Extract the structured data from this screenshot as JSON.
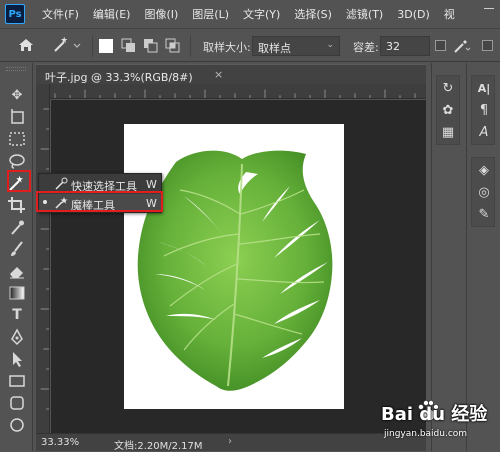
{
  "app": {
    "logo": "Ps"
  },
  "menu": [
    "文件(F)",
    "编辑(E)",
    "图像(I)",
    "图层(L)",
    "文字(Y)",
    "选择(S)",
    "滤镜(T)",
    "3D(D)",
    "视"
  ],
  "options": {
    "sample_size_label": "取样大小:",
    "sample_size_value": "取样点",
    "tolerance_label": "容差:",
    "tolerance_value": "32"
  },
  "document": {
    "tab_title": "叶子.jpg @ 33.3%(RGB/8#)",
    "close_glyph": "×"
  },
  "flyout": {
    "items": [
      {
        "label": "快速选择工具",
        "shortcut": "W"
      },
      {
        "label": "魔棒工具",
        "shortcut": "W"
      }
    ]
  },
  "status": {
    "zoom": "33.33%",
    "doc_size": "文档:2.20M/2.17M",
    "arrow": "›"
  },
  "watermark": {
    "brand": "Bai du 经验",
    "url": "jingyan.baidu.com"
  },
  "colors": {
    "highlight": "#e01e1e",
    "leaf": "#6cb43f",
    "accent": "#31a8ff"
  }
}
